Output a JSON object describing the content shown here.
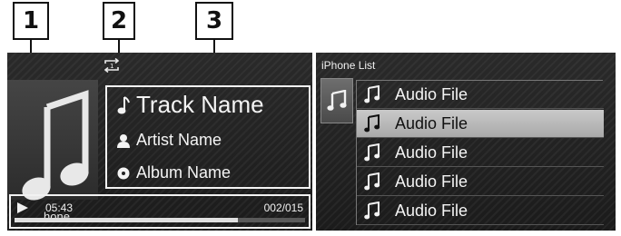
{
  "callouts": [
    "1",
    "2",
    "3"
  ],
  "now_playing": {
    "art_label": "hone",
    "track_name": "Track Name",
    "artist_name": "Artist Name",
    "album_name": "Album Name",
    "elapsed": "05:43",
    "track_count": "002/015",
    "progress": 0.77,
    "icons": {
      "art": "music-note-icon",
      "repeat": "repeat-one-icon",
      "track": "music-note-icon",
      "artist": "person-icon",
      "album": "disc-icon",
      "play": "play-icon"
    }
  },
  "list_panel": {
    "title": "iPhone List",
    "tab_icon": "music-note-icon",
    "items": [
      {
        "label": "Audio File",
        "selected": false
      },
      {
        "label": "Audio File",
        "selected": true
      },
      {
        "label": "Audio File",
        "selected": false
      },
      {
        "label": "Audio File",
        "selected": false
      },
      {
        "label": "Audio File",
        "selected": false
      }
    ]
  },
  "colors": {
    "panel": "#222222",
    "selected_row": "#b8b8b8",
    "text": "#f4f4f4"
  }
}
